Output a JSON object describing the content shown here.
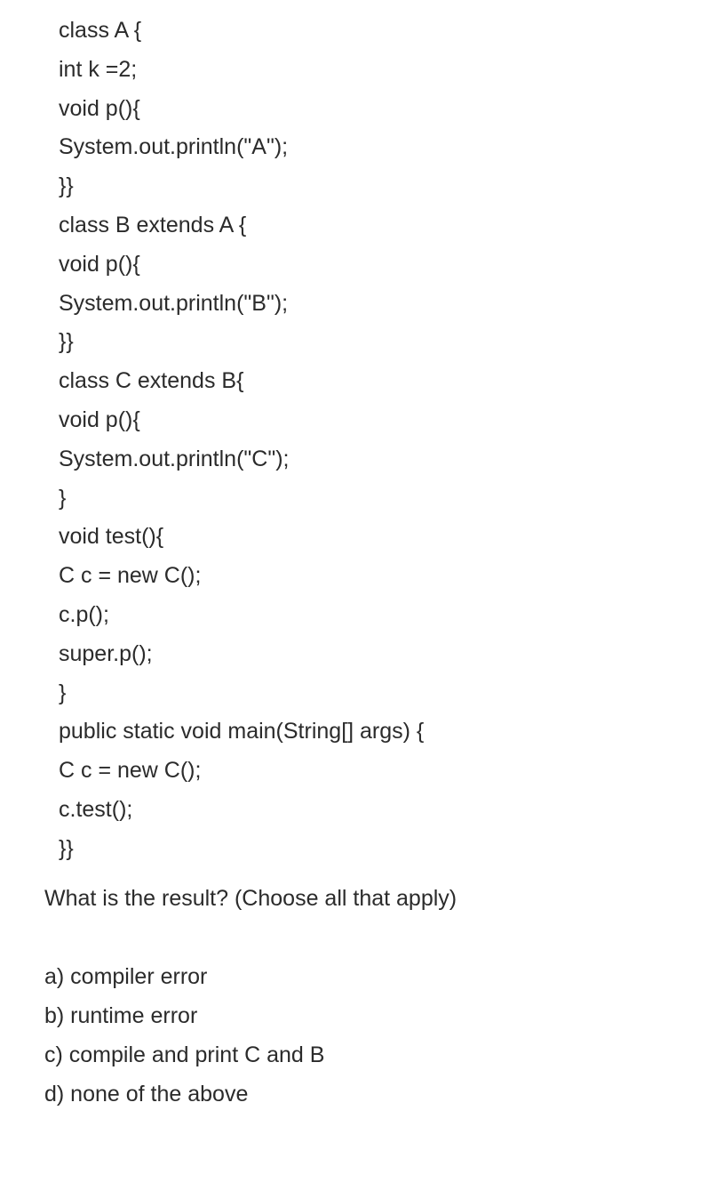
{
  "code": {
    "lines": [
      "class A {",
      "int k =2;",
      "void p(){",
      "System.out.println(\"A\");",
      "}}",
      "class B extends A {",
      "void p(){",
      "System.out.println(\"B\");",
      "}}",
      "class C extends B{",
      "void p(){",
      "System.out.println(\"C\");",
      "}",
      "void test(){",
      "C c = new C();",
      "c.p();",
      "super.p();",
      "}",
      "public static void main(String[] args) {",
      "C c = new C();",
      "c.test();",
      "}}"
    ]
  },
  "question": {
    "text": "What is the result? (Choose all that apply)"
  },
  "options": [
    "a) compiler error",
    "b) runtime error",
    "c) compile and print C and B",
    "d) none of the above"
  ]
}
